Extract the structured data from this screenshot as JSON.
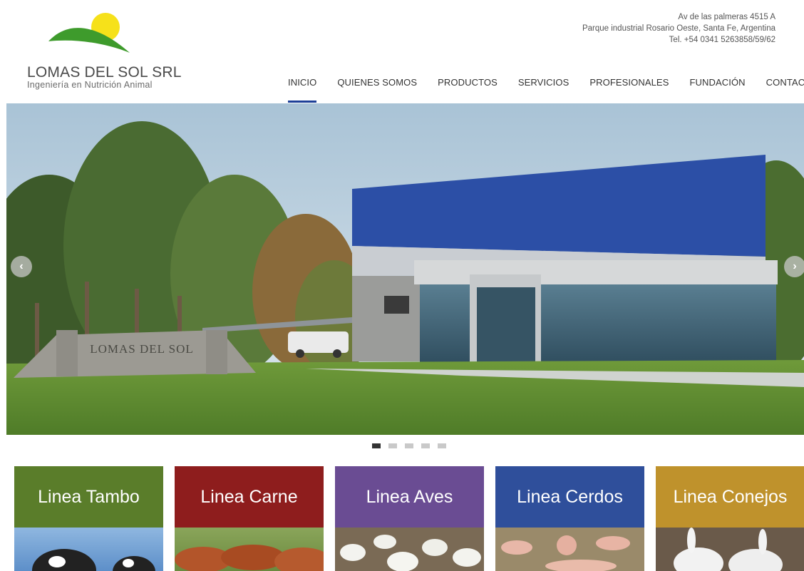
{
  "brand": {
    "title": "LOMAS DEL SOL SRL",
    "subtitle": "Ingeniería en Nutrición Animal",
    "logo_colors": {
      "sun": "#f6e11a",
      "hill": "#3e9b2c"
    }
  },
  "contact": {
    "address": "Av de las palmeras 4515 A",
    "location": "Parque industrial Rosario Oeste, Santa Fe, Argentina",
    "phone": "Tel. +54 0341 5263858/59/62"
  },
  "nav": {
    "items": [
      {
        "label": "INICIO",
        "active": true
      },
      {
        "label": "QUIENES SOMOS",
        "active": false
      },
      {
        "label": "PRODUCTOS",
        "active": false
      },
      {
        "label": "SERVICIOS",
        "active": false
      },
      {
        "label": "PROFESIONALES",
        "active": false
      },
      {
        "label": "FUNDACIÓN",
        "active": false
      },
      {
        "label": "CONTACTO",
        "active": false
      }
    ],
    "accent": "#1d3f97"
  },
  "hero": {
    "sign_text": "LOMAS DEL SOL",
    "prev_icon": "chevron-left-icon",
    "next_icon": "chevron-right-icon",
    "prev_glyph": "‹",
    "next_glyph": "›",
    "slides_count": 5,
    "active_slide": 1
  },
  "product_lines": [
    {
      "label": "Linea Tambo",
      "color": "#5a7d2a"
    },
    {
      "label": "Linea Carne",
      "color": "#8e1d1d"
    },
    {
      "label": "Linea Aves",
      "color": "#6a4c93"
    },
    {
      "label": "Linea Cerdos",
      "color": "#2f4f9b"
    },
    {
      "label": "Linea Conejos",
      "color": "#bf922c"
    }
  ]
}
